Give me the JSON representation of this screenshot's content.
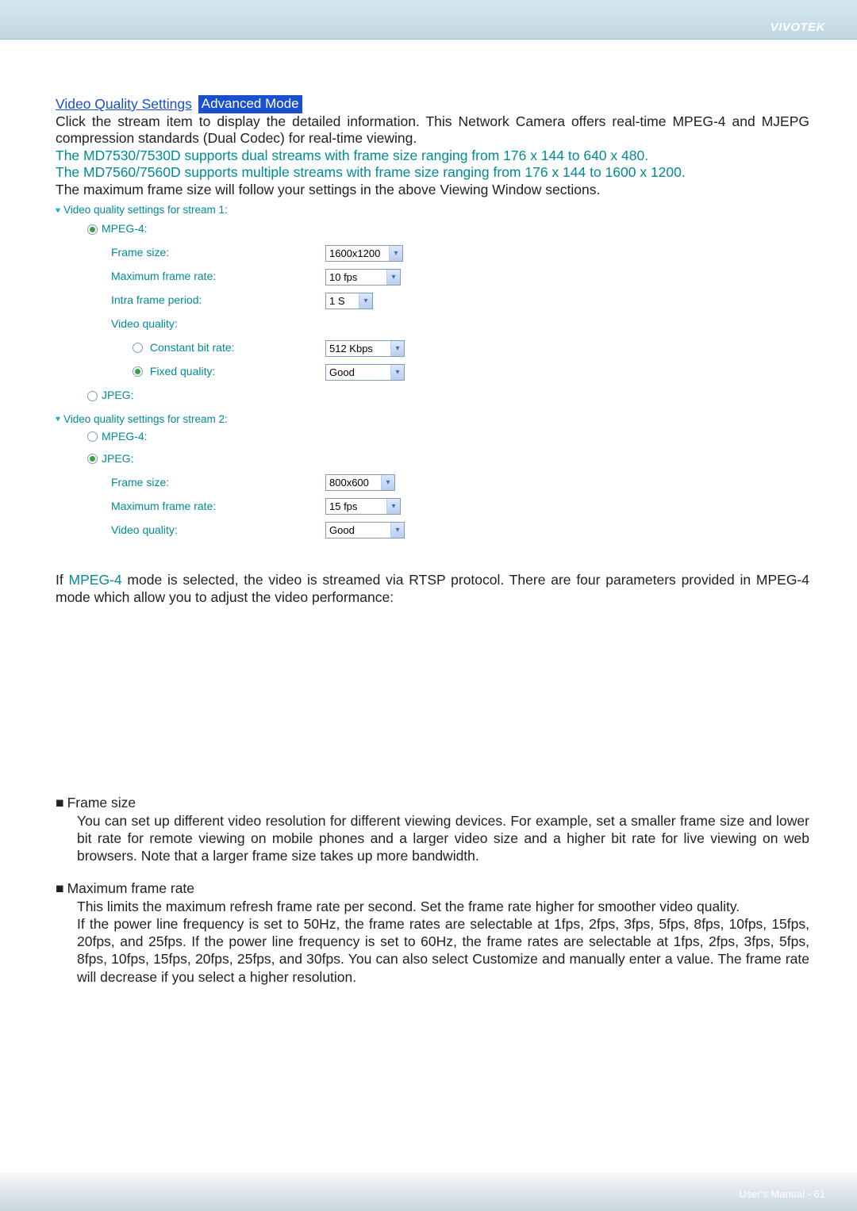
{
  "brand": "VIVOTEK",
  "heading_link": "Video Quality Settings",
  "badge": "Advanced Mode",
  "intro_line1": "Click the stream item to display the detailed information. This Network Camera offers real-time MPEG-4 and MJEPG compression standards (Dual Codec) for real-time viewing.",
  "intro_line2": "The MD7530/7530D supports dual streams with frame size ranging from 176 x 144 to 640 x 480.",
  "intro_line3": "The MD7560/7560D supports multiple streams with frame size ranging from 176 x 144 to 1600 x 1200.",
  "intro_line4": "The maximum frame size will follow your settings in the above Viewing Window sections.",
  "stream1_title": "Video quality settings for stream 1:",
  "stream2_title": "Video quality settings for stream 2:",
  "labels": {
    "mpeg4": "MPEG-4:",
    "jpeg": "JPEG:",
    "frame_size": "Frame size:",
    "max_frame_rate": "Maximum frame rate:",
    "intra_period": "Intra frame period:",
    "video_quality": "Video quality:",
    "constant_bit": "Constant bit rate:",
    "fixed_quality": "Fixed quality:"
  },
  "s1": {
    "frame_size": "1600x1200",
    "max_rate": "10 fps",
    "intra": "1 S",
    "bitrate": "512 Kbps",
    "quality": "Good"
  },
  "s2": {
    "frame_size": "800x600",
    "max_rate": "15 fps",
    "quality": "Good"
  },
  "mpeg_para": "If MPEG-4 mode is selected, the video is streamed via RTSP protocol. There are four parameters provided in MPEG-4 mode which allow you to adjust the video performance:",
  "mpeg_word": "MPEG-4",
  "sec_frame_title": "Frame size",
  "sec_frame_body": "You can set up different video resolution for different viewing devices. For example, set a smaller frame size and lower bit rate for remote viewing on mobile phones and a larger video size and a higher bit rate for live viewing on web browsers. Note that a larger frame size takes up more bandwidth.",
  "sec_max_title": "Maximum frame rate",
  "sec_max_body1": "This limits the maximum refresh frame rate per second. Set the frame rate higher for smoother video quality.",
  "sec_max_body2": "If the power line frequency is set to 50Hz, the frame rates are selectable at 1fps, 2fps, 3fps, 5fps, 8fps, 10fps, 15fps, 20fps, and 25fps. If the power line frequency is set to 60Hz, the frame rates are selectable at 1fps, 2fps, 3fps, 5fps, 8fps, 10fps, 15fps, 20fps, 25fps, and 30fps. You can also select Customize and manually enter a value. The frame rate will decrease if you select a higher resolution.",
  "footer": "User's Manual - 61",
  "bullet": "■"
}
